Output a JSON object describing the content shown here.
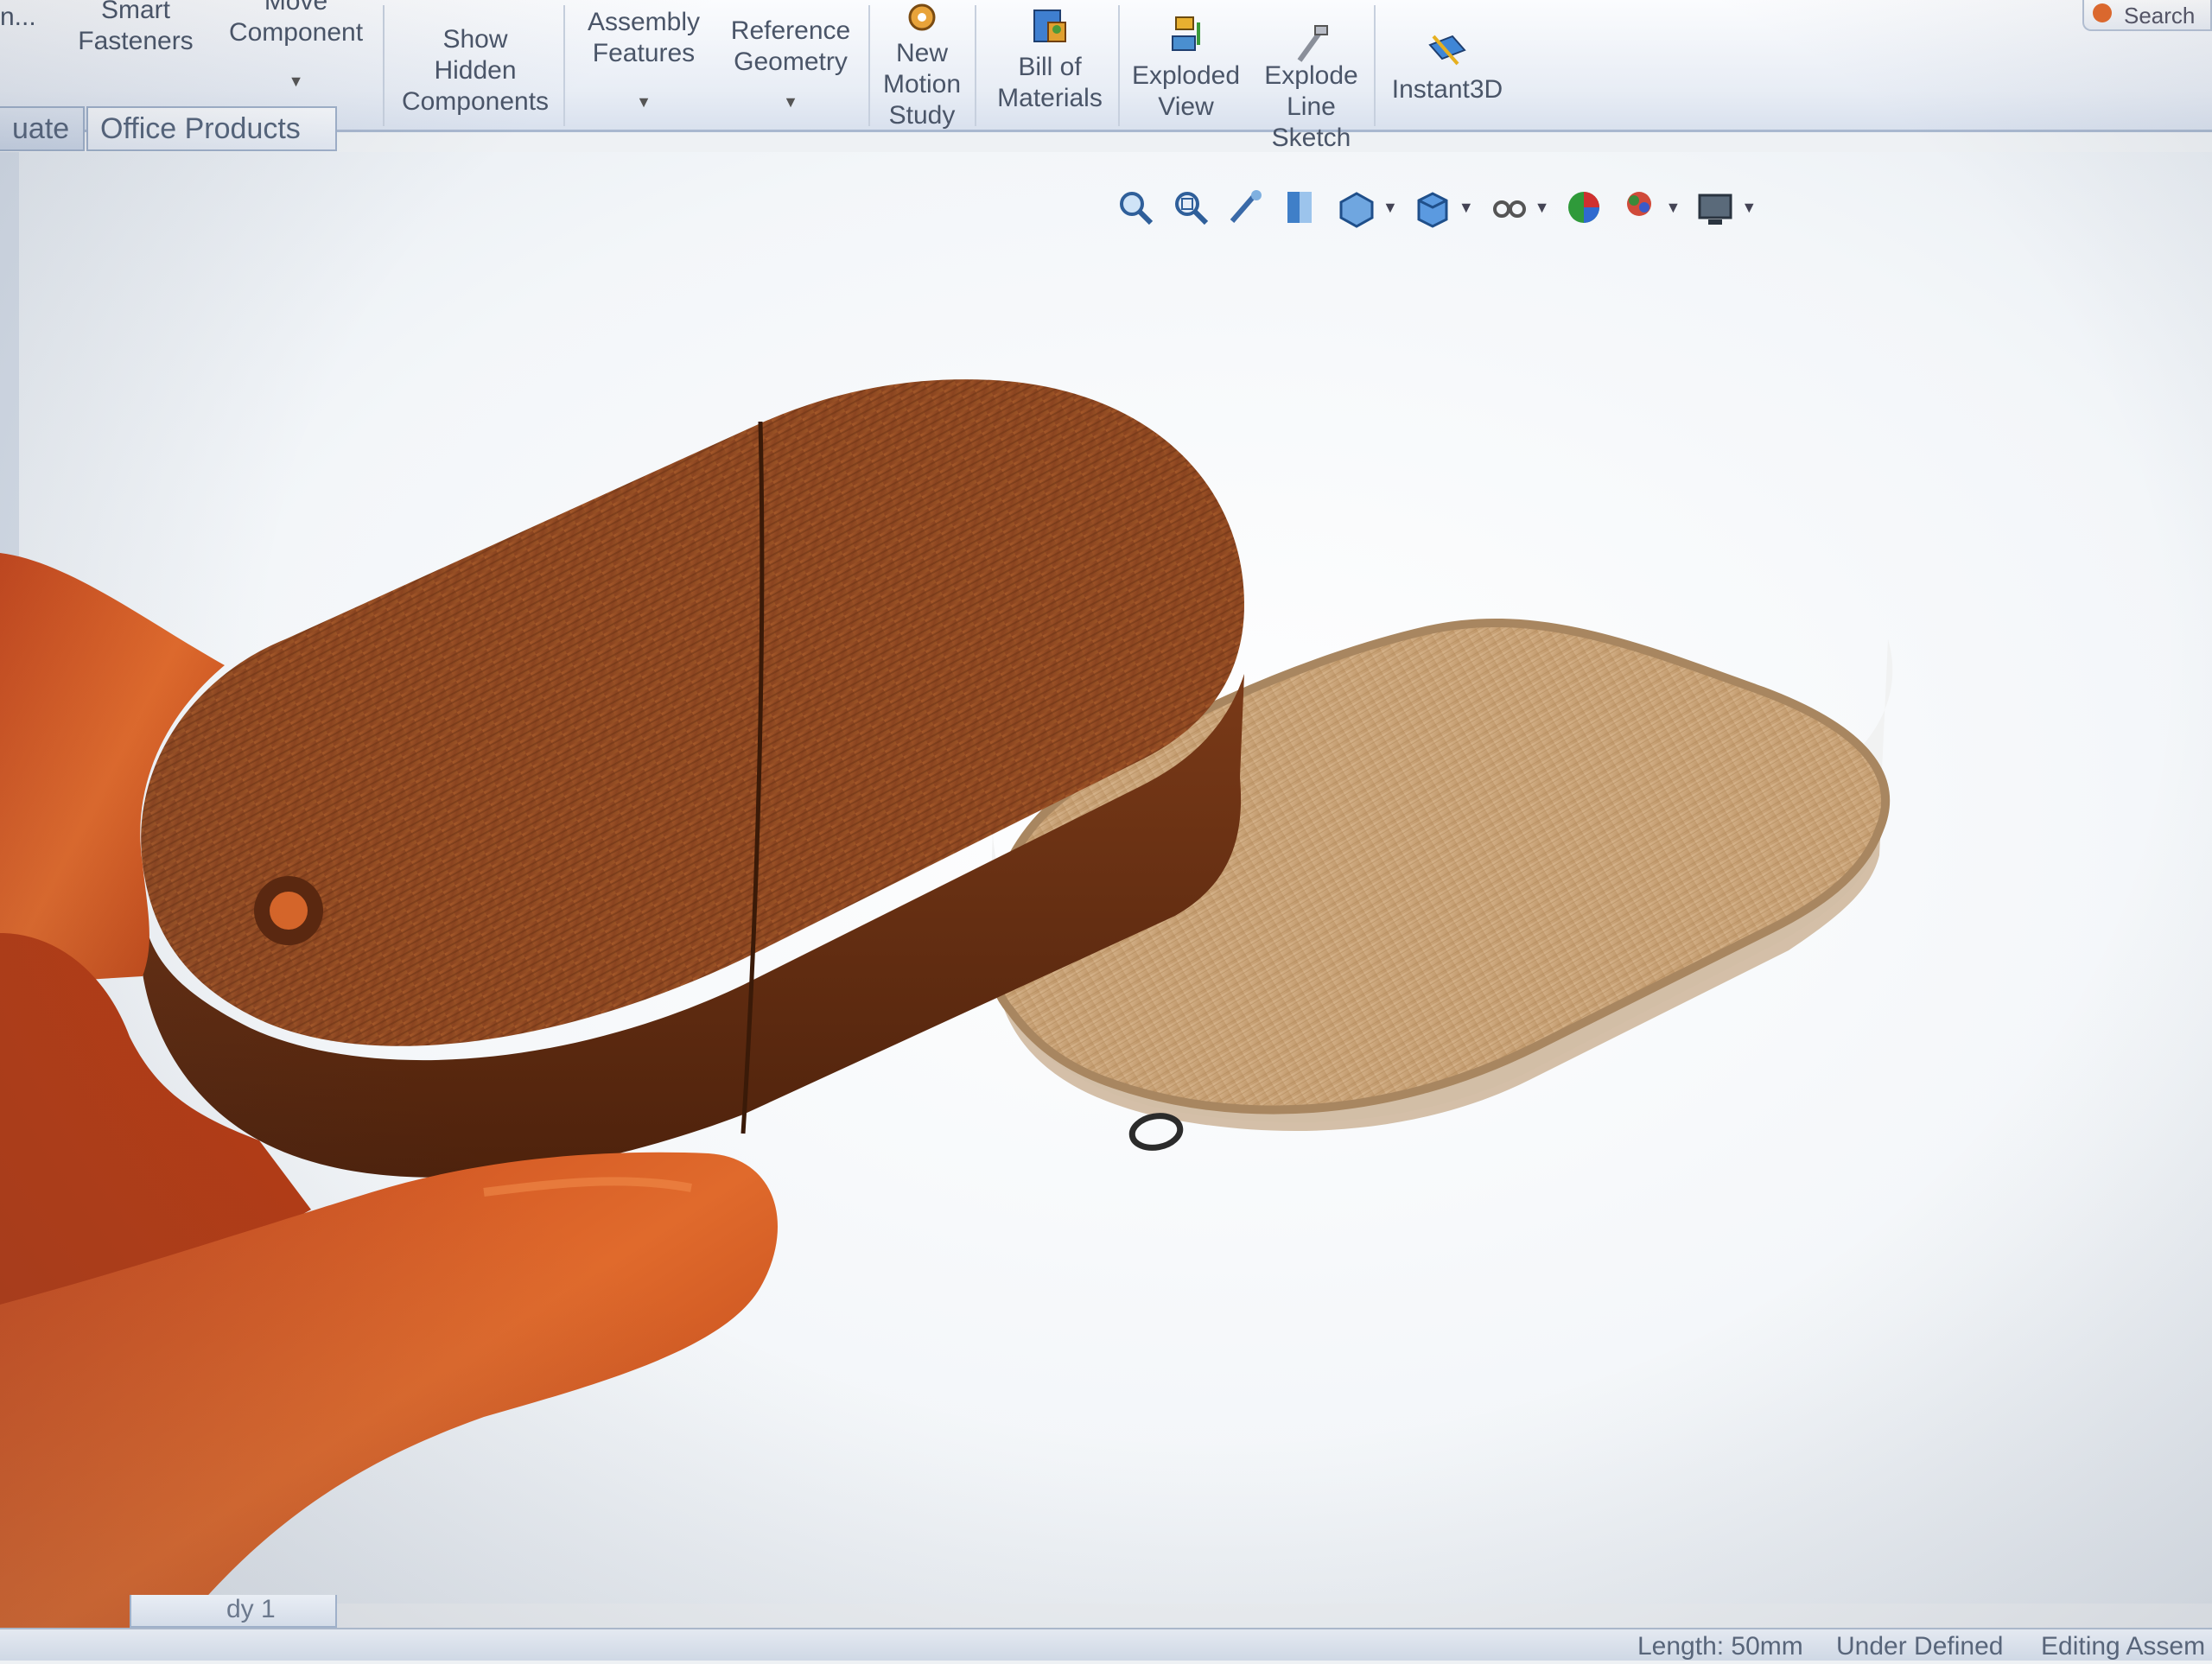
{
  "ribbon": {
    "buttons": [
      {
        "label": "n...",
        "icon": "truncated-icon"
      },
      {
        "label": "Smart\nFasteners",
        "icon": "smart-fasteners-icon"
      },
      {
        "label": "Move\nComponent",
        "icon": "move-component-icon",
        "has_dropdown": true
      },
      {
        "label": "Show\nHidden\nComponents",
        "icon": "show-hidden-icon"
      },
      {
        "label": "Assembly\nFeatures",
        "icon": "assembly-features-icon",
        "has_dropdown": true
      },
      {
        "label": "Reference\nGeometry",
        "icon": "reference-geometry-icon",
        "has_dropdown": true
      },
      {
        "label": "New\nMotion\nStudy",
        "icon": "motion-study-icon"
      },
      {
        "label": "Bill of\nMaterials",
        "icon": "bill-of-materials-icon"
      },
      {
        "label": "Exploded\nView",
        "icon": "exploded-view-icon"
      },
      {
        "label": "Explode\nLine\nSketch",
        "icon": "explode-line-sketch-icon"
      },
      {
        "label": "Instant3D",
        "icon": "instant3d-icon"
      }
    ],
    "search_label": "Search"
  },
  "tabs": [
    {
      "label": "uate",
      "active": false
    },
    {
      "label": "Office Products",
      "active": true
    }
  ],
  "heads_up_toolbar": [
    "zoom-to-fit-icon",
    "zoom-to-area-icon",
    "previous-view-icon",
    "section-view-icon",
    "view-orientation-icon",
    "display-style-icon",
    "hide-show-items-icon",
    "edit-appearance-icon",
    "apply-scene-icon",
    "view-settings-icon"
  ],
  "bottom_tab": {
    "label": "dy 1"
  },
  "status": {
    "length": "Length: 50mm",
    "state": "Under Defined",
    "mode": "Editing Assem"
  },
  "colors": {
    "ribbon_text": "#4a5568",
    "wood_dark": "#8a4a22",
    "wood_light": "#c9a57e",
    "skin": "#d8602a"
  }
}
